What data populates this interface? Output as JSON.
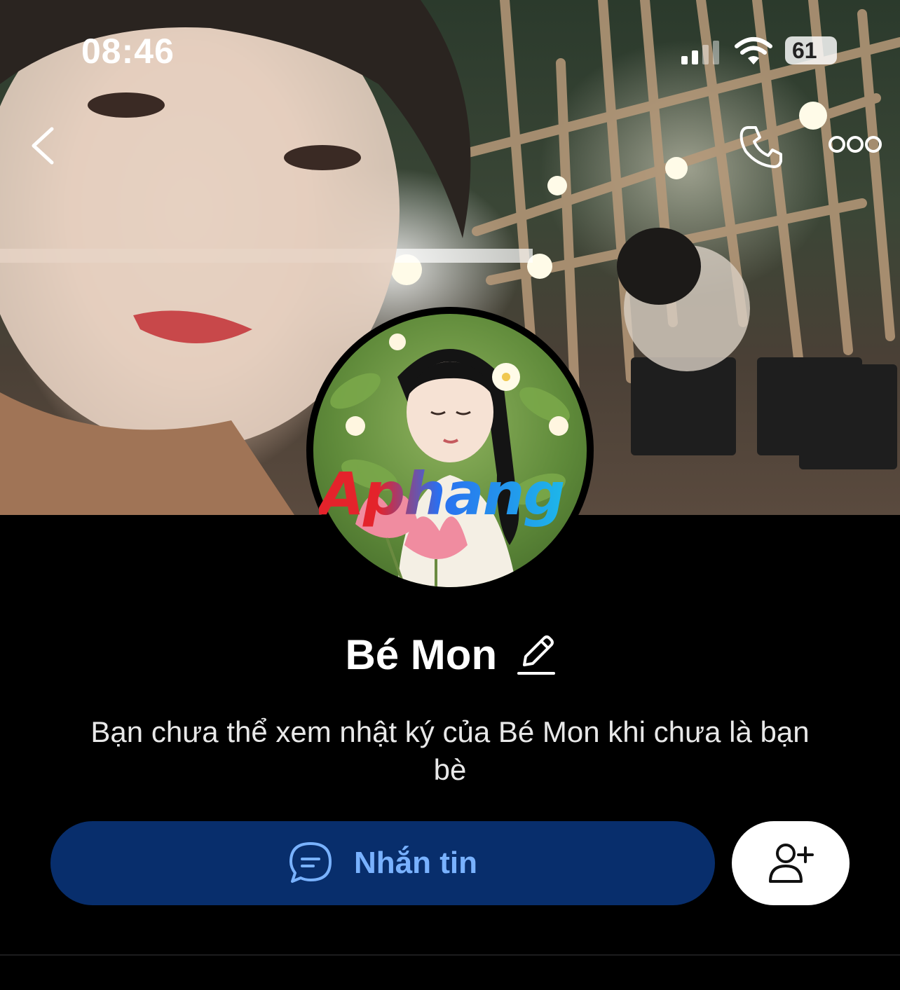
{
  "status_bar": {
    "time": "08:46",
    "battery_level": "61",
    "signal_icon": "cellular-signal-icon",
    "wifi_icon": "wifi-icon"
  },
  "nav": {
    "back_icon": "chevron-left-icon",
    "call_icon": "phone-icon",
    "more_icon": "more-horizontal-icon"
  },
  "profile": {
    "name": "Bé Mon",
    "edit_icon": "pencil-icon",
    "watermark": "Aphang",
    "notice": "Bạn chưa thể xem nhật ký của Bé Mon khi chưa là bạn bè"
  },
  "actions": {
    "message_label": "Nhắn tin",
    "message_icon": "chat-bubble-icon",
    "add_friend_icon": "add-friend-icon"
  },
  "colors": {
    "background": "#000000",
    "primary_button": "#082e6c",
    "primary_button_text": "#79b2ff",
    "secondary_button": "#ffffff"
  }
}
